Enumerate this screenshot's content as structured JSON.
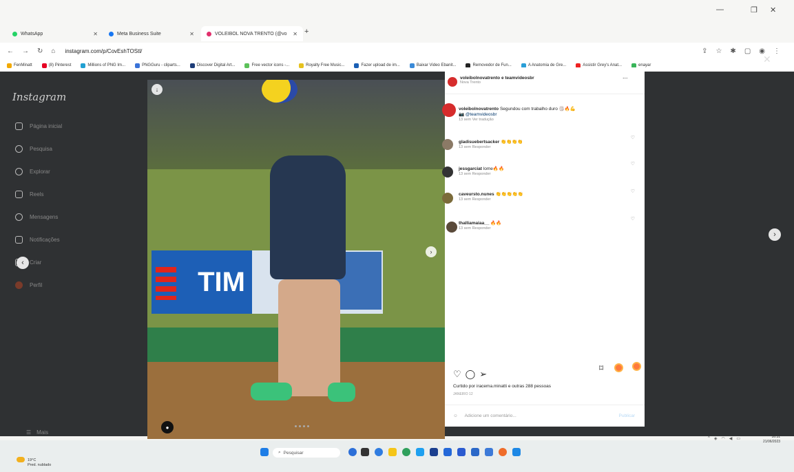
{
  "browser": {
    "tabs": [
      {
        "label": "WhatsApp",
        "color": "#25d366"
      },
      {
        "label": "Meta Business Suite",
        "color": "#1877f2"
      },
      {
        "label": "VOLEIBOL NOVA TRENTO (@vo",
        "color": "#e1306c"
      }
    ],
    "new_tab": "+",
    "url": "instagram.com/p/CovEshTOStl/",
    "bookmarks": [
      "FenMinatt",
      "(8) Pinterest",
      "Millions of PNG Im...",
      "PNGGuru - cliparts...",
      "Discover Digital Art...",
      "Free vector icons -...",
      "Royalty Free Music...",
      "Fazer upload de im...",
      "Baixar Video Ebanit...",
      "Removedor de Fun...",
      "A Anatomia de Gre...",
      "Assistir Grey's Anat...",
      "enayar"
    ]
  },
  "instagram": {
    "logo": "Instagram",
    "sidebar": [
      {
        "label": "Página inicial",
        "icon": "home-icon"
      },
      {
        "label": "Pesquisa",
        "icon": "search-icon"
      },
      {
        "label": "Explorar",
        "icon": "compass-icon"
      },
      {
        "label": "Reels",
        "icon": "reels-icon"
      },
      {
        "label": "Mensagens",
        "icon": "messenger-icon"
      },
      {
        "label": "Notificações",
        "icon": "heart-icon"
      },
      {
        "label": "Criar",
        "icon": "plus-icon"
      },
      {
        "label": "Perfil",
        "icon": "profile-icon"
      }
    ],
    "more": "Mais",
    "banner_text": "TIM"
  },
  "post": {
    "header_user": "voleibolnovatrento e teamvideosbr",
    "location": "Nova Trento",
    "more": "...",
    "caption_user": "voleibolnovatrento",
    "caption": "Segundou com trabalho duro 🏐🔥💪",
    "caption_tag": "📷 @teamvideosbr",
    "caption_meta": "13 sem   Ver tradução",
    "comments": [
      {
        "user": "gladisuebertsacker",
        "text": "👏👏👏👏",
        "meta": "13 sem   Responder"
      },
      {
        "user": "jessgarciat",
        "text": "lome🔥🔥",
        "meta": "13 sem   Responder"
      },
      {
        "user": "caveursto.nunes",
        "text": "👏👏👏👏👏",
        "meta": "13 sem   Responder"
      },
      {
        "user": "thalliamaiaa__",
        "text": "🔥🔥",
        "meta": "13 sem   Responder"
      }
    ],
    "likes": "Curtido por iracema.minatti e outras 288 pessoas",
    "date": "JANEIRO 12",
    "add_comment_placeholder": "Adicione um comentário...",
    "publish": "Publicar"
  },
  "taskbar": {
    "weather_temp": "19°C",
    "weather_desc": "Pred. nublado",
    "search": "Pesquisar",
    "time": "16:31",
    "date": "21/06/2023"
  }
}
